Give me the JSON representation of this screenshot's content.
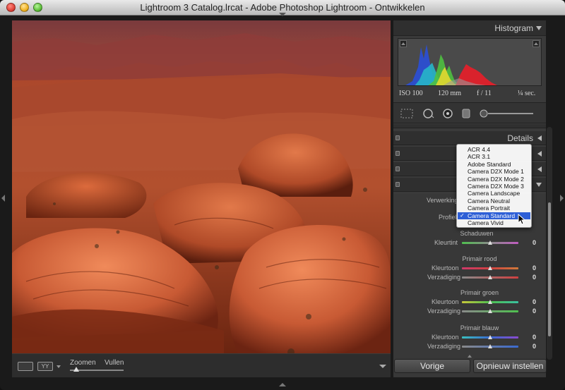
{
  "window": {
    "title": "Lightroom 3 Catalog.lrcat - Adobe Photoshop Lightroom - Ontwikkelen"
  },
  "colors": {
    "selection": "#2e5fd6",
    "panel_bg": "#3a3a3a",
    "histogram_red": "#e0202a",
    "histogram_blue": "#2a4fd8",
    "histogram_green": "#4fc040"
  },
  "histogram": {
    "title": "Histogram",
    "iso": "ISO 100",
    "focal": "120 mm",
    "aperture": "f / 11",
    "shutter": "¼ sec."
  },
  "sections": {
    "details": "Details"
  },
  "camera_calibration": {
    "process_label": "Verwerking",
    "profile_label": "Profiel",
    "shadows_title": "Schaduwen",
    "shadows": [
      {
        "label": "Kleurtint",
        "value": "0"
      }
    ],
    "red_title": "Primair rood",
    "red": [
      {
        "label": "Kleurtoon",
        "value": "0"
      },
      {
        "label": "Verzadiging",
        "value": "0"
      }
    ],
    "green_title": "Primair groen",
    "green": [
      {
        "label": "Kleurtoon",
        "value": "0"
      },
      {
        "label": "Verzadiging",
        "value": "0"
      }
    ],
    "blue_title": "Primair blauw",
    "blue": [
      {
        "label": "Kleurtoon",
        "value": "0"
      },
      {
        "label": "Verzadiging",
        "value": "0"
      }
    ]
  },
  "profile_menu": {
    "options": [
      "ACR 4.4",
      "ACR 3.1",
      "Adobe Standard",
      "Camera D2X Mode 1",
      "Camera D2X Mode 2",
      "Camera D2X Mode 3",
      "Camera Landscape",
      "Camera Neutral",
      "Camera Portrait",
      "Camera Standard",
      "Camera Vivid"
    ],
    "selected": "Camera Standard",
    "selected_index": 9
  },
  "toolbar": {
    "zoom_label": "Zoomen",
    "fill_label": "Vullen",
    "yy_label": "YY"
  },
  "buttons": {
    "previous": "Vorige",
    "reset": "Opnieuw instellen"
  }
}
